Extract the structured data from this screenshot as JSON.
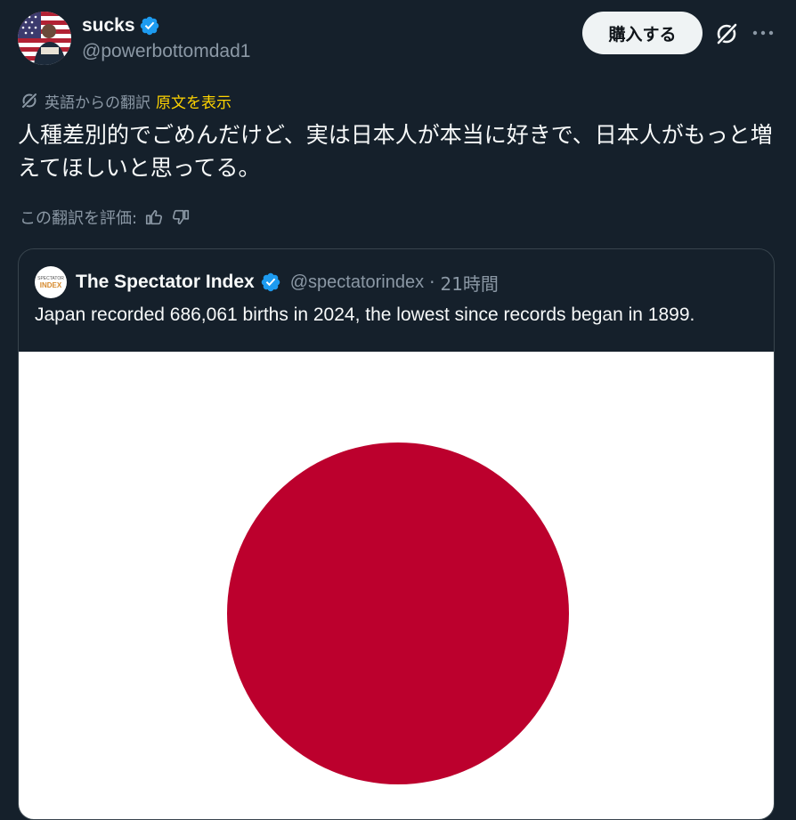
{
  "author": {
    "display_name": "sucks",
    "handle": "@powerbottomdad1",
    "verified": true,
    "avatar_icon": "avatar-flag-photo"
  },
  "header": {
    "buy_label": "購入する",
    "grok_icon": "grok-icon",
    "more_icon": "more-icon"
  },
  "translation": {
    "label": "英語からの翻訳",
    "show_original": "原文を表示",
    "icon": "translate-icon",
    "accent": "#ffd400"
  },
  "tweet": {
    "text": "人種差別的でごめんだけど、実は日本人が本当に好きで、日本人がもっと増えてほしいと思ってる。"
  },
  "rating": {
    "label": "この翻訳を評価:",
    "up_icon": "thumbs-up-icon",
    "down_icon": "thumbs-down-icon"
  },
  "quote": {
    "display_name": "The Spectator Index",
    "handle": "@spectatorindex",
    "separator": "·",
    "time": "21時間",
    "verified": true,
    "avatar_text_1": "SPECTATOR",
    "avatar_text_2": "INDEX",
    "text": "Japan recorded 686,061 births in 2024, the lowest since records began in 1899.",
    "media": "japan-flag-image",
    "flag_red": "#bc002d",
    "flag_white": "#ffffff"
  },
  "colors": {
    "background": "#15202b",
    "text": "#f7f9f9",
    "muted": "#8b98a5",
    "verified_blue": "#1d9bf0",
    "border": "#38444d"
  }
}
